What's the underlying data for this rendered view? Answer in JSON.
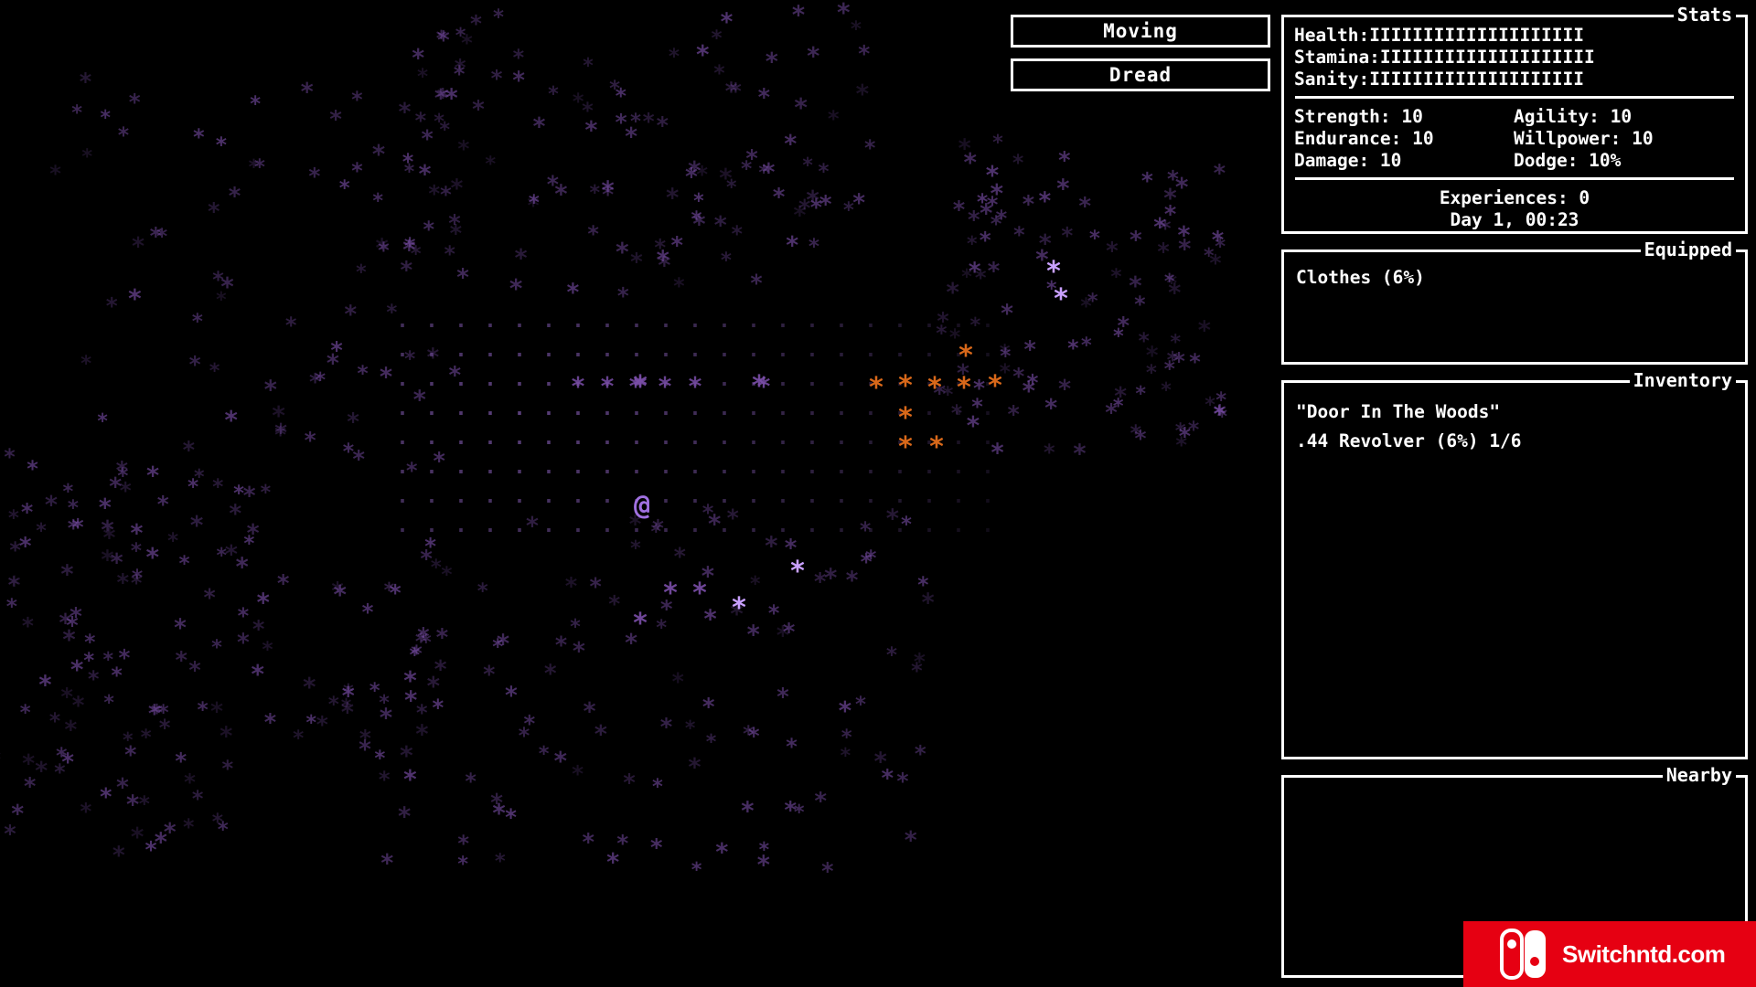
{
  "status_buttons": {
    "mode": "Moving",
    "state": "Dread"
  },
  "stats": {
    "title": "Stats",
    "health_label": "Health:",
    "health_bar": "IIIIIIIIIIIIIIIIIIII",
    "stamina_label": "Stamina:",
    "stamina_bar": "IIIIIIIIIIIIIIIIIIII",
    "sanity_label": "Sanity:",
    "sanity_bar": "IIIIIIIIIIIIIIIIIIII",
    "strength": "Strength: 10",
    "agility": "Agility: 10",
    "endurance": "Endurance: 10",
    "willpower": "Willpower: 10",
    "damage": "Damage: 10",
    "dodge": "Dodge: 10%",
    "experiences": "Experiences: 0",
    "day_time": "Day 1, 00:23"
  },
  "equipped": {
    "title": "Equipped",
    "items": [
      "Clothes (6%)"
    ]
  },
  "inventory": {
    "title": "Inventory",
    "items": [
      "\"Door In The Woods\"",
      ".44 Revolver (6%) 1/6"
    ]
  },
  "nearby": {
    "title": "Nearby",
    "items": []
  },
  "map": {
    "player_glyph": "@",
    "tree_glyph": "*",
    "floor_glyph": "·",
    "colors": {
      "player": "#a070e0",
      "tree": "#7a4ea8",
      "tree_bright": "#c9a0ff",
      "tree_orange": "#d8681a",
      "floor": "#6a4a90"
    }
  },
  "watermark": {
    "text": "Switchntd.com",
    "color": "#e60012"
  }
}
